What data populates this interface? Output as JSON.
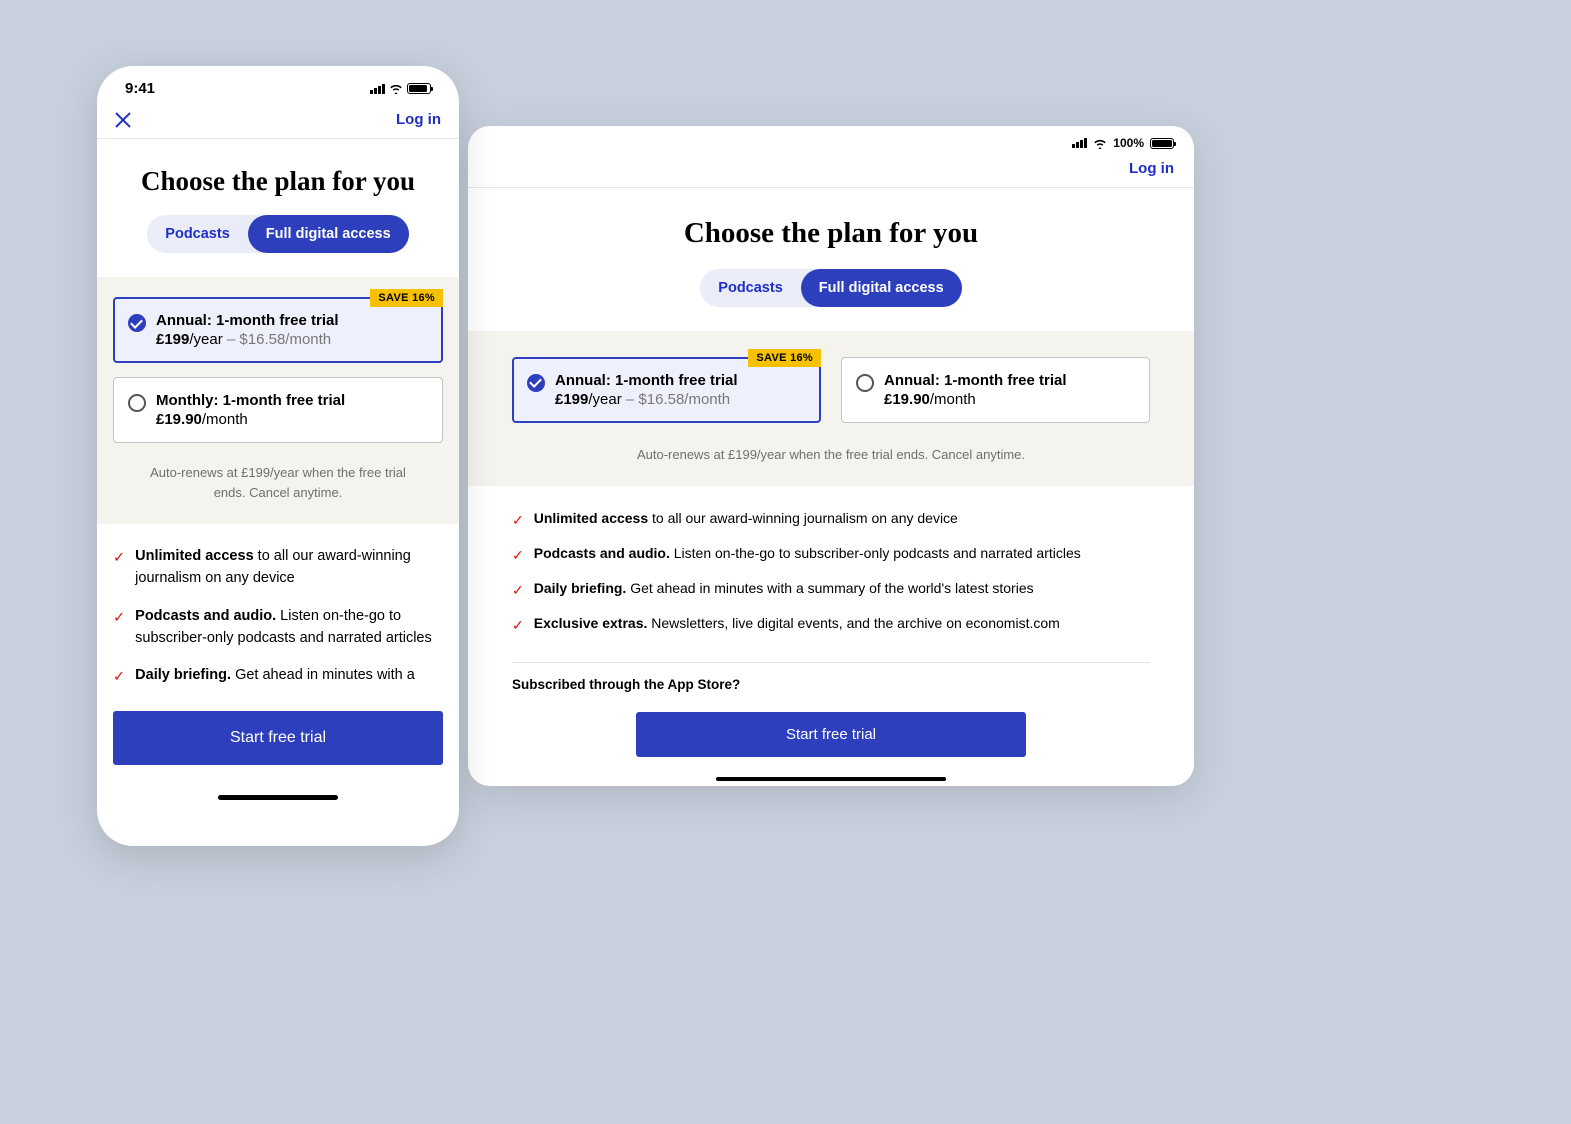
{
  "phone": {
    "status_time": "9:41",
    "login_label": "Log in",
    "headline": "Choose the plan for you",
    "toggle": {
      "podcasts": "Podcasts",
      "full": "Full digital access"
    },
    "plan_annual": {
      "save_badge": "SAVE 16%",
      "title": "Annual: 1-month free trial",
      "price_main": "£199",
      "price_unit": "/year",
      "price_sub": " – $16.58/month"
    },
    "plan_monthly": {
      "title": "Monthly: 1-month free trial",
      "price_main": "£19.90",
      "price_unit": "/month"
    },
    "renew_note": "Auto-renews at £199/year when the free trial ends. Cancel anytime.",
    "features": [
      {
        "bold": "Unlimited access",
        "rest": " to all our award-winning journalism on any device"
      },
      {
        "bold": "Podcasts and audio.",
        "rest": " Listen on-the-go to subscriber-only podcasts and narrated articles"
      },
      {
        "bold": "Daily briefing.",
        "rest": " Get ahead in minutes with a"
      }
    ],
    "cta": "Start free trial"
  },
  "tablet": {
    "status_battery": "100%",
    "login_label": "Log in",
    "headline": "Choose the plan for you",
    "toggle": {
      "podcasts": "Podcasts",
      "full": "Full digital access"
    },
    "plan_annual": {
      "save_badge": "SAVE 16%",
      "title": "Annual: 1-month free trial",
      "price_main": "£199",
      "price_unit": "/year",
      "price_sub": " – $16.58/month"
    },
    "plan_annual2": {
      "title": "Annual: 1-month free trial",
      "price_main": "£19.90",
      "price_unit": "/month"
    },
    "renew_note": "Auto-renews at £199/year when the free trial ends. Cancel anytime.",
    "features": [
      {
        "bold": "Unlimited access",
        "rest": " to all our award-winning journalism on any device"
      },
      {
        "bold": "Podcasts and audio.",
        "rest": " Listen on-the-go to subscriber-only podcasts and narrated articles"
      },
      {
        "bold": "Daily briefing.",
        "rest": " Get ahead in minutes with a summary of the world's latest stories"
      },
      {
        "bold": "Exclusive extras.",
        "rest": " Newsletters, live digital events, and the archive on economist.com"
      }
    ],
    "appstore_q": "Subscribed through the App Store?",
    "cta": "Start free trial"
  }
}
